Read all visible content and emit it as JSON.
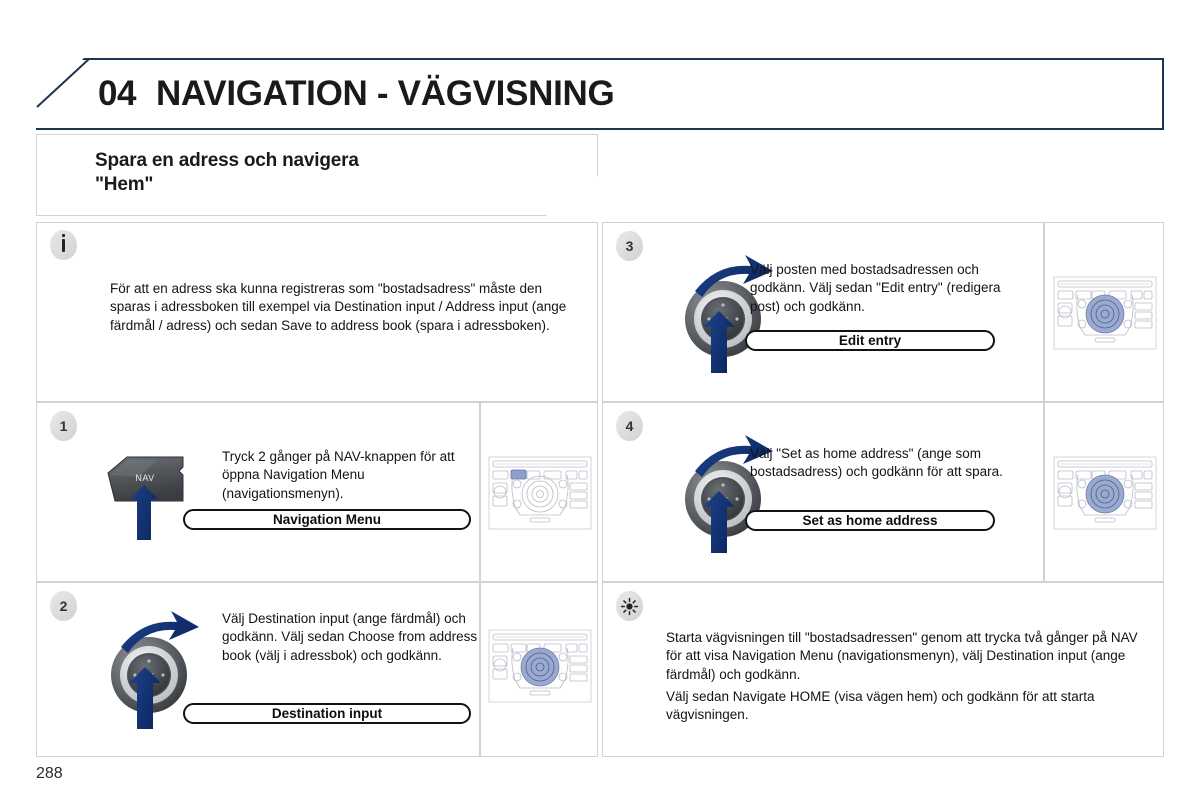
{
  "page": {
    "number": "288",
    "chapter_number": "04",
    "chapter_title": "NAVIGATION - VÄGVISNING",
    "section_title": "Spara en adress och navigera\n\"Hem\""
  },
  "colors": {
    "banner_border": "#1f3353",
    "panel_border": "#d2d2d2",
    "arrow_blue": "#123a7a",
    "highlight_blue": "#8a9fd0",
    "badge_grey": "#dcdcdc"
  },
  "left_column": {
    "info_note": {
      "icon": "info-icon",
      "text": "För att en adress ska kunna registreras som \"bostadsadress\" måste den sparas i adressboken till exempel via Destination input / Address input (ange färdmål / adress) och sedan Save to address book (spara i adressboken)."
    },
    "steps": [
      {
        "number": "1",
        "graphic": "nav-button",
        "text": "Tryck 2 gånger på NAV-knappen för att öppna Navigation Menu (navigationsmenyn).",
        "button_label": "Navigation Menu",
        "nav_key_label": "NAV",
        "thumbnail": "center-console-nav-button-highlighted"
      },
      {
        "number": "2",
        "graphic": "rotary-knob",
        "text": "Välj Destination input (ange färdmål) och godkänn. Välj sedan Choose from address book (välj i adressbok) och godkänn.",
        "button_label": "Destination input",
        "thumbnail": "center-console-rotary-knob-highlighted"
      }
    ]
  },
  "right_column": {
    "steps": [
      {
        "number": "3",
        "graphic": "rotary-knob",
        "text": "Välj posten med bostadsadressen och godkänn. Välj sedan \"Edit entry\" (redigera post) och godkänn.",
        "button_label": "Edit entry",
        "thumbnail": "center-console-rotary-knob-highlighted"
      },
      {
        "number": "4",
        "graphic": "rotary-knob",
        "text": "Välj \"Set as home address\" (ange som bostadsadress) och godkänn för att spara.",
        "button_label": "Set as home address",
        "thumbnail": "center-console-rotary-knob-highlighted"
      }
    ],
    "tip_note": {
      "icon": "tip-sun-icon",
      "paragraph_1": "Starta vägvisningen till \"bostadsadressen\" genom att trycka två gånger på NAV för att visa Navigation Menu (navigationsmenyn), välj Destination input (ange färdmål) och godkänn.",
      "paragraph_2": "Välj sedan Navigate HOME (visa vägen hem) och godkänn för att starta vägvisningen."
    }
  }
}
